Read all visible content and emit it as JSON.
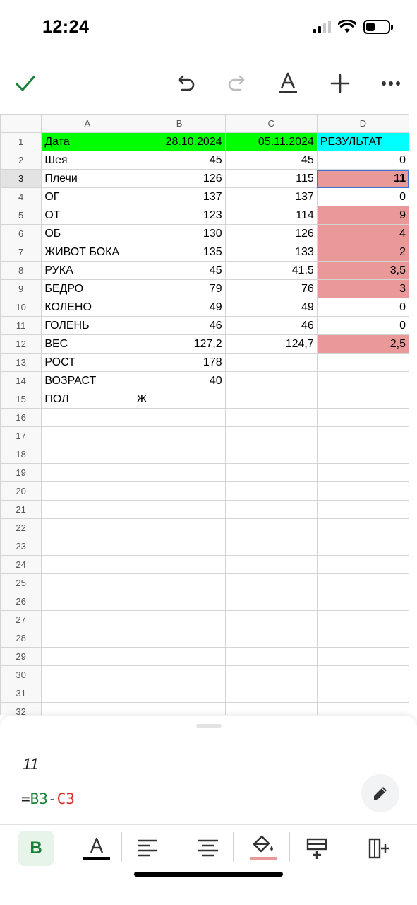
{
  "status": {
    "time": "12:24",
    "battery_level": 0.4
  },
  "toolbar": {
    "icons": [
      "checkmark-icon",
      "undo-icon",
      "redo-icon",
      "text-format-icon",
      "add-icon",
      "more-icon"
    ],
    "accent_color": "#188038"
  },
  "sheet": {
    "columns": [
      "A",
      "B",
      "C",
      "D"
    ],
    "active_column": "D",
    "active_row": "3",
    "rows": [
      {
        "num": "1",
        "a": "Дата",
        "b": "28.10.2024",
        "c": "05.11.2024",
        "d": "РЕЗУЛЬТАТ"
      },
      {
        "num": "2",
        "a": "Шея",
        "b": "45",
        "c": "45",
        "d": "0"
      },
      {
        "num": "3",
        "a": "Плечи",
        "b": "126",
        "c": "115",
        "d": "11"
      },
      {
        "num": "4",
        "a": "ОГ",
        "b": "137",
        "c": "137",
        "d": "0"
      },
      {
        "num": "5",
        "a": "ОТ",
        "b": "123",
        "c": "114",
        "d": "9"
      },
      {
        "num": "6",
        "a": "ОБ",
        "b": "130",
        "c": "126",
        "d": "4"
      },
      {
        "num": "7",
        "a": "ЖИВОТ БОКА",
        "b": "135",
        "c": "133",
        "d": "2"
      },
      {
        "num": "8",
        "a": "РУКА",
        "b": "45",
        "c": "41,5",
        "d": "3,5"
      },
      {
        "num": "9",
        "a": "БЕДРО",
        "b": "79",
        "c": "76",
        "d": "3"
      },
      {
        "num": "10",
        "a": "КОЛЕНО",
        "b": "49",
        "c": "49",
        "d": "0"
      },
      {
        "num": "11",
        "a": "ГОЛЕНЬ",
        "b": "46",
        "c": "46",
        "d": "0"
      },
      {
        "num": "12",
        "a": "ВЕС",
        "b": "127,2",
        "c": "124,7",
        "d": "2,5"
      },
      {
        "num": "13",
        "a": "РОСТ",
        "b": "178",
        "c": "",
        "d": ""
      },
      {
        "num": "14",
        "a": "ВОЗРАСТ",
        "b": "40",
        "c": "",
        "d": ""
      },
      {
        "num": "15",
        "a": "ПОЛ",
        "b": "Ж",
        "c": "",
        "d": ""
      }
    ],
    "empty_rows": [
      "16",
      "17",
      "18",
      "19",
      "20",
      "21",
      "22",
      "23",
      "24",
      "25",
      "26",
      "27",
      "28",
      "29",
      "30",
      "31",
      "32"
    ],
    "colors": {
      "header_green": "#00ff00",
      "header_cyan": "#00ffff",
      "highlight_pink": "#ea9999",
      "selection_blue": "#3b74d6"
    }
  },
  "editor": {
    "cell_value": "11",
    "formula_eq": "=",
    "formula_ref1": "B3",
    "formula_op": "-",
    "formula_ref2": "C3",
    "ref1_color": "#188038",
    "ref2_color": "#d93025"
  },
  "format_bar": {
    "bold_label": "B",
    "icons": [
      "bold-icon",
      "text-color-icon",
      "align-left-icon",
      "align-center-icon",
      "fill-color-icon",
      "insert-row-icon",
      "insert-column-icon"
    ]
  }
}
